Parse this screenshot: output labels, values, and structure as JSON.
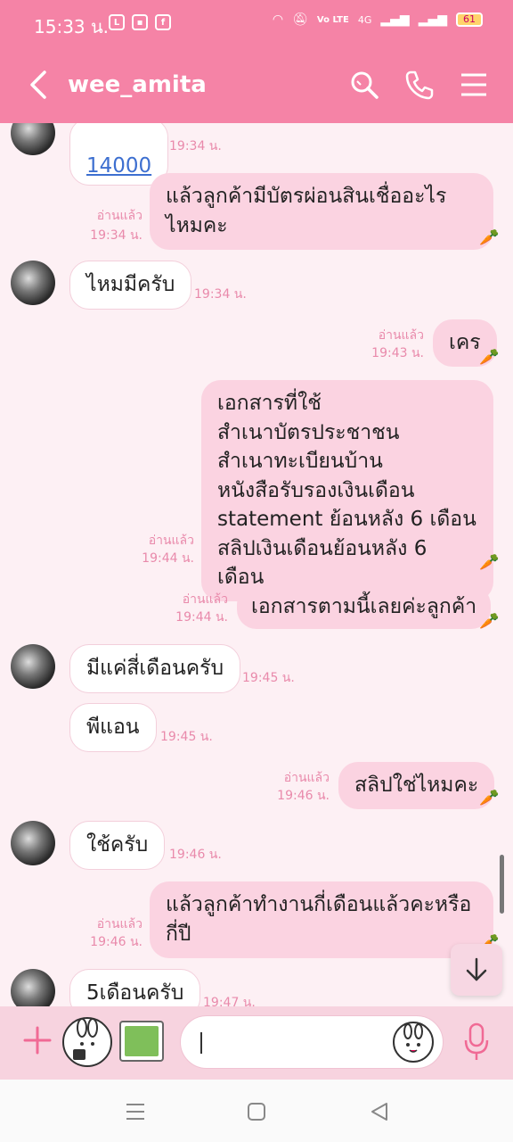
{
  "status_bar": {
    "time": "15:33 น.",
    "network": "4G",
    "battery": "61",
    "volte": "Vo LTE"
  },
  "header": {
    "title": "wee_amita"
  },
  "messages": [
    {
      "dir": "in",
      "text": "14000",
      "time": "19:34 น.",
      "link": true
    },
    {
      "dir": "out",
      "text": "แล้วลูกค้ามีบัตรผ่อนสินเชื่ออะไร\nไหมคะ",
      "read": "อ่านแล้ว",
      "time": "19:34 น."
    },
    {
      "dir": "in",
      "text": "ไหมมีครับ",
      "time": "19:34 น."
    },
    {
      "dir": "out",
      "text": "เคร",
      "read": "อ่านแล้ว",
      "time": "19:43 น."
    },
    {
      "dir": "out",
      "text": "เอกสารที่ใช้\nสำเนาบัตรประชาชน\nสำเนาทะเบียนบ้าน\nหนังสือรับรองเงินเดือน\nstatement ย้อนหลัง 6 เดือน\nสลิปเงินเดือนย้อนหลัง 6 เดือน",
      "read": "อ่านแล้ว",
      "time": "19:44 น."
    },
    {
      "dir": "out",
      "text": "เอกสารตามนี้เลยค่ะลูกค้า",
      "read": "อ่านแล้ว",
      "time": "19:44 น."
    },
    {
      "dir": "in",
      "text": "มีแค่สี่เดือนครับ",
      "time": "19:45 น."
    },
    {
      "dir": "in",
      "text": "พีแอน",
      "time": "19:45 น."
    },
    {
      "dir": "out",
      "text": "สลิปใช่ไหมคะ",
      "read": "อ่านแล้ว",
      "time": "19:46 น."
    },
    {
      "dir": "in",
      "text": "ใช้ครับ",
      "time": "19:46 น."
    },
    {
      "dir": "out",
      "text": "แล้วลูกค้าทำงานกี่เดือนแล้วคะหรือ\nกี่ปี",
      "read": "อ่านแล้ว",
      "time": "19:46 น."
    },
    {
      "dir": "in",
      "text": "5เดือนครับ",
      "time": "19:47 น."
    }
  ],
  "input": {
    "placeholder": ""
  },
  "colors": {
    "header": "#f583a6",
    "chat_bg": "#fdf0f4",
    "out_bubble": "#fbd3e1",
    "meta": "#e98aab"
  },
  "icons": [
    "back-arrow-icon",
    "search-icon",
    "phone-icon",
    "menu-icon",
    "plus-icon",
    "sticker-icon",
    "image-icon",
    "emoji-icon",
    "mic-icon",
    "scroll-down-icon"
  ]
}
